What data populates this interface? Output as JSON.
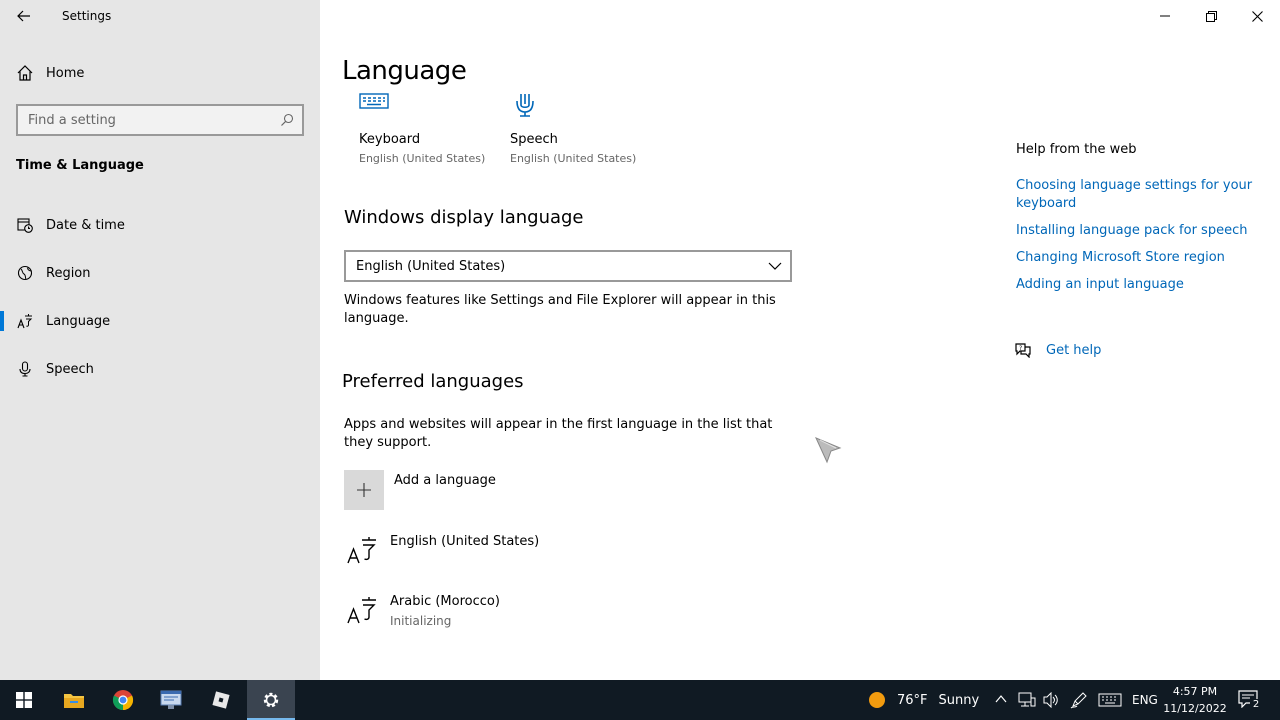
{
  "window": {
    "title": "Settings"
  },
  "sidebar": {
    "home_label": "Home",
    "search_placeholder": "Find a setting",
    "section_title": "Time & Language",
    "items": [
      {
        "label": "Date & time",
        "icon": "calendar-clock-icon",
        "selected": false
      },
      {
        "label": "Region",
        "icon": "globe-icon",
        "selected": false
      },
      {
        "label": "Language",
        "icon": "language-icon",
        "selected": true
      },
      {
        "label": "Speech",
        "icon": "microphone-icon",
        "selected": false
      }
    ]
  },
  "main": {
    "title": "Language",
    "quick_links": [
      {
        "label": "Keyboard",
        "sub": "English (United States)",
        "icon": "keyboard-icon"
      },
      {
        "label": "Speech",
        "sub": "English (United States)",
        "icon": "microphone-icon"
      }
    ],
    "display_language": {
      "heading": "Windows display language",
      "selected": "English (United States)",
      "description": "Windows features like Settings and File Explorer will appear in this language."
    },
    "preferred": {
      "heading": "Preferred languages",
      "description": "Apps and websites will appear in the first language in the list that they support.",
      "add_label": "Add a language",
      "languages": [
        {
          "name": "English (United States)",
          "status": ""
        },
        {
          "name": "Arabic (Morocco)",
          "status": "Initializing"
        }
      ]
    }
  },
  "help": {
    "title": "Help from the web",
    "links": [
      "Choosing language settings for your keyboard",
      "Installing language pack for speech",
      "Changing Microsoft Store region",
      "Adding an input language"
    ],
    "get_help": "Get help"
  },
  "taskbar": {
    "weather_temp": "76°F",
    "weather_text": "Sunny",
    "input_lang": "ENG",
    "time": "4:57 PM",
    "date": "11/12/2022",
    "notifications": "2"
  },
  "colors": {
    "accent": "#0078d7",
    "link": "#0067b8",
    "sidebar_bg": "#e6e6e6",
    "taskbar_bg": "#101a23"
  }
}
